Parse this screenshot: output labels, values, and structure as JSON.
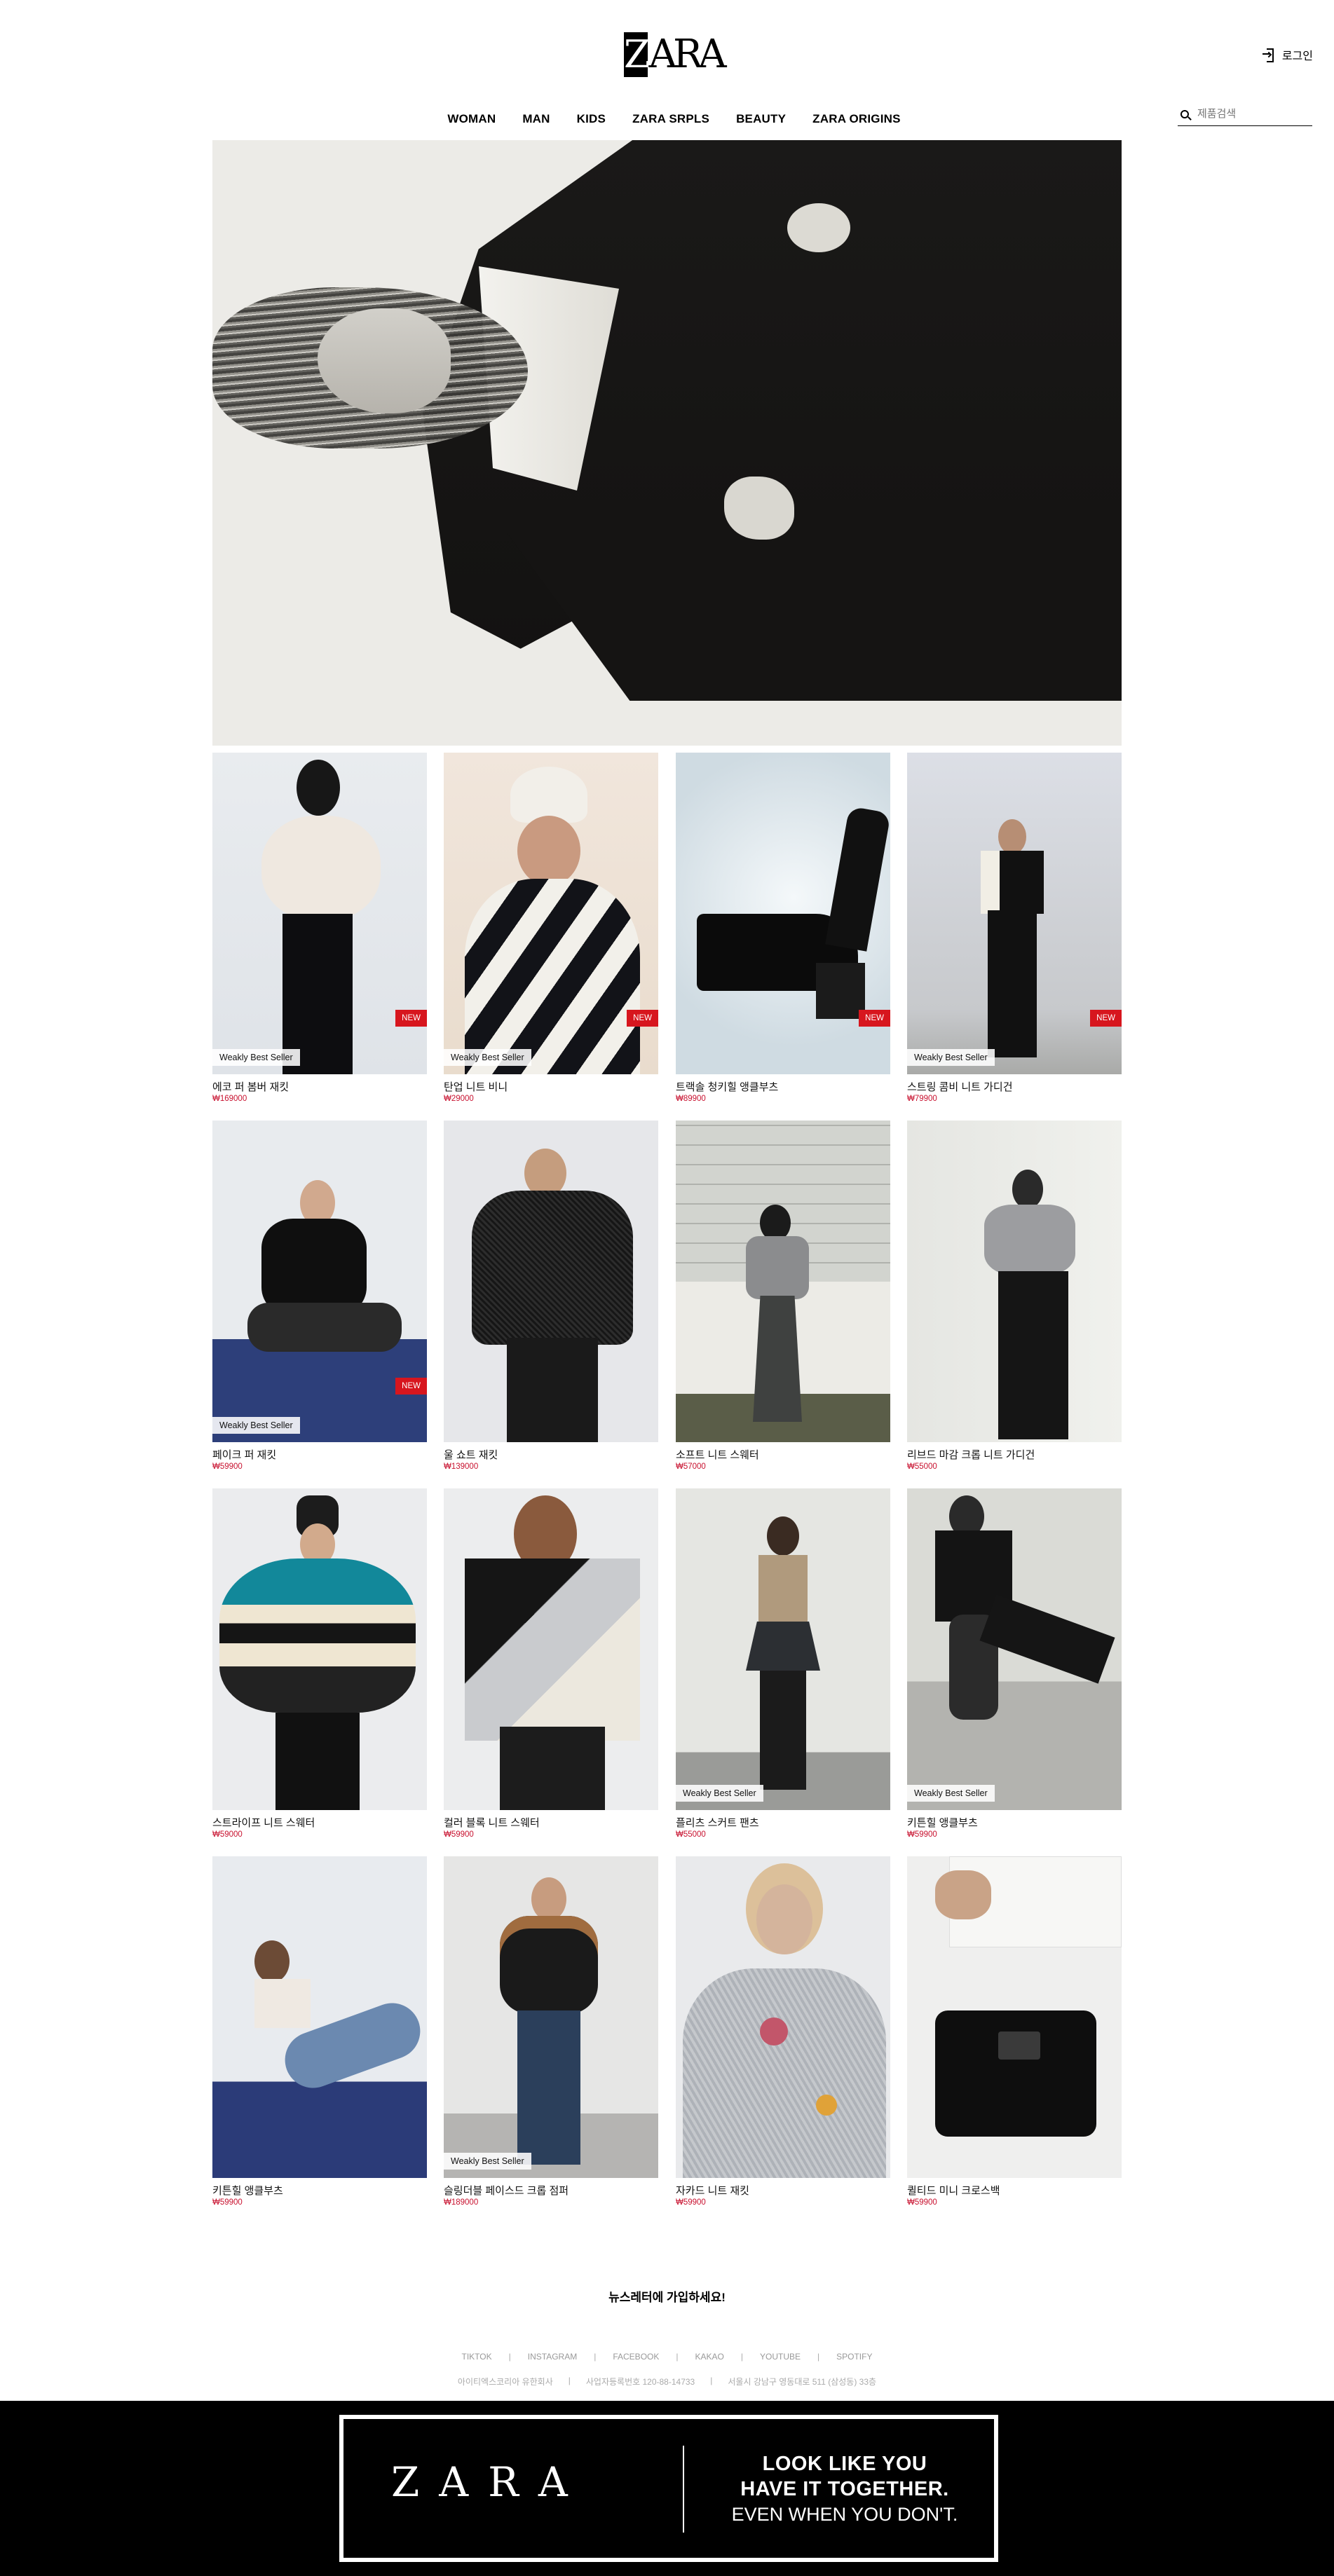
{
  "header": {
    "logo": "ZARA",
    "login_label": "로그인",
    "search_placeholder": "제품검색",
    "nav": [
      "WOMAN",
      "MAN",
      "KIDS",
      "ZARA SRPLS",
      "BEAUTY",
      "ZARA ORIGINS"
    ]
  },
  "colors": {
    "accent": "#d7161e",
    "price": "#c8102e",
    "banner_bg": "#000000"
  },
  "products": [
    {
      "name": "에코 퍼 봄버 재킷",
      "price": "₩169000",
      "best": "Weakly Best Seller",
      "new": "NEW"
    },
    {
      "name": "탄업 니트 비니",
      "price": "₩29000",
      "best": "Weakly Best Seller",
      "new": "NEW"
    },
    {
      "name": "트랙솔 청키힐 앵클부츠",
      "price": "₩89900",
      "best": "",
      "new": "NEW"
    },
    {
      "name": "스트링 콤비 니트 가디건",
      "price": "₩79900",
      "best": "Weakly Best Seller",
      "new": "NEW"
    },
    {
      "name": "페이크 퍼 재킷",
      "price": "₩59900",
      "best": "Weakly Best Seller",
      "new": "NEW"
    },
    {
      "name": "울 쇼트 재킷",
      "price": "₩139000",
      "best": "",
      "new": ""
    },
    {
      "name": "소프트 니트 스웨터",
      "price": "₩57000",
      "best": "",
      "new": ""
    },
    {
      "name": "리브드 마감 크롭 니트 가디건",
      "price": "₩55000",
      "best": "",
      "new": ""
    },
    {
      "name": "스트라이프 니트 스웨터",
      "price": "₩59000",
      "best": "",
      "new": ""
    },
    {
      "name": "컬러 블록 니트 스웨터",
      "price": "₩59900",
      "best": "",
      "new": ""
    },
    {
      "name": "플리츠 스커트 팬츠",
      "price": "₩55000",
      "best": "Weakly Best Seller",
      "new": ""
    },
    {
      "name": "키튼힐 앵클부츠",
      "price": "₩59900",
      "best": "Weakly Best Seller",
      "new": ""
    },
    {
      "name": "키튼힐 앵클부츠",
      "price": "₩59900",
      "best": "",
      "new": ""
    },
    {
      "name": "슬링더블 페이스드 크롭 점퍼",
      "price": "₩189000",
      "best": "Weakly Best Seller",
      "new": ""
    },
    {
      "name": "자카드 니트 재킷",
      "price": "₩59900",
      "best": "",
      "new": ""
    },
    {
      "name": "퀼티드 미니 크로스백",
      "price": "₩59900",
      "best": "",
      "new": ""
    }
  ],
  "footer": {
    "newsletter": "뉴스레터에 가입하세요!",
    "social": [
      "TIKTOK",
      "INSTAGRAM",
      "FACEBOOK",
      "KAKAO",
      "YOUTUBE",
      "SPOTIFY"
    ],
    "social_sep": "|",
    "company": [
      "아이티엑스코리아 유한회사",
      "사업자등록번호 120-88-14733",
      "서울시 강남구 영동대로 511 (삼성동) 33층"
    ]
  },
  "banner": {
    "logo": "ZARA",
    "line1": "LOOK LIKE YOU",
    "line2": "HAVE IT TOGETHER.",
    "line3": "EVEN WHEN YOU DON'T."
  }
}
